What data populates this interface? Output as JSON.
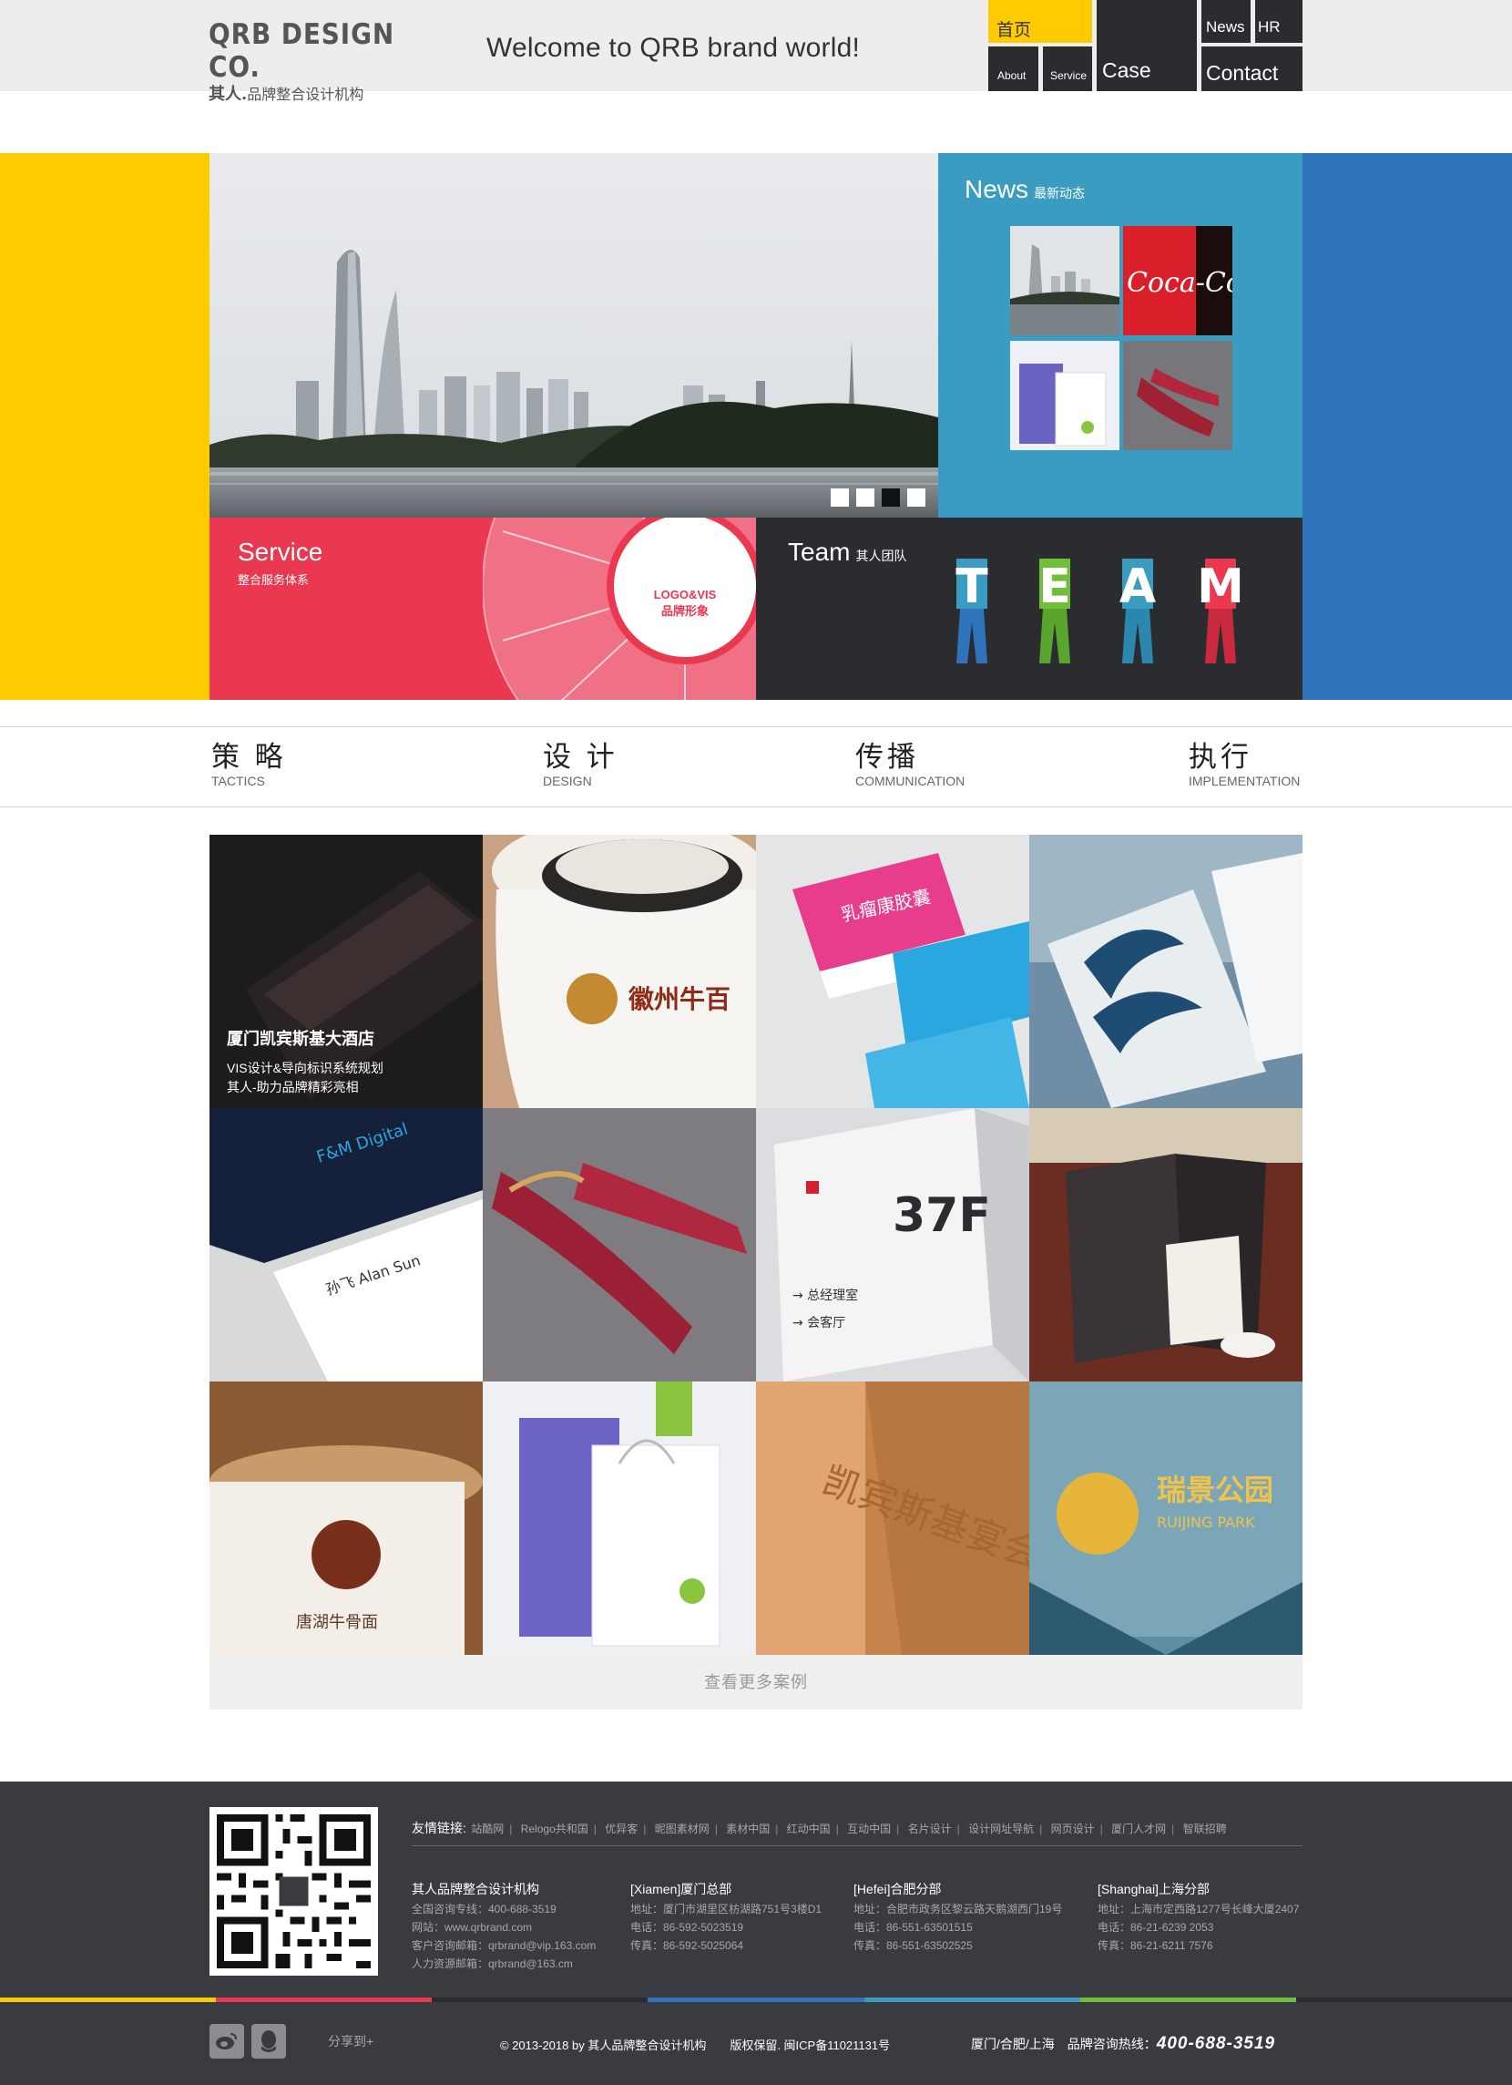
{
  "header": {
    "logo_main": "QRB DESIGN CO.",
    "logo_mark": "其人.",
    "logo_sub": "品牌整合设计机构",
    "welcome": "Welcome to QRB brand world!",
    "nav": {
      "home": "首页",
      "about": "About",
      "service": "Service",
      "case": "Case",
      "news": "News",
      "hr": "HR",
      "contact": "Contact"
    }
  },
  "banner": {
    "slider_dots": 4,
    "active_dot": 3,
    "news": {
      "title": "News",
      "subtitle": "最新动态"
    },
    "service": {
      "title": "Service",
      "subtitle": "整合服务体系",
      "center_line1": "LOGO&VIS",
      "center_line2": "品牌形象"
    },
    "team": {
      "title": "Team",
      "subtitle": "其人团队",
      "letters": [
        "T",
        "E",
        "A",
        "M"
      ]
    }
  },
  "strategy": [
    {
      "cn": "策 略",
      "en": "TACTICS"
    },
    {
      "cn": "设 计",
      "en": "DESIGN"
    },
    {
      "cn": "传播",
      "en": "COMMUNICATION"
    },
    {
      "cn": "执行",
      "en": "IMPLEMENTATION"
    }
  ],
  "cases": {
    "featured": {
      "title": "厦门凯宾斯基大酒店",
      "line1": "VIS设计&导向标识系统规划",
      "line2": "其人-助力品牌精彩亮相"
    },
    "more": "查看更多案例"
  },
  "footer": {
    "links_label": "友情链接:",
    "links": [
      "站酷网",
      "Relogo共和国",
      "优异客",
      "昵图素材网",
      "素材中国",
      "红动中国",
      "互动中国",
      "名片设计",
      "设计网址导航",
      "网页设计",
      "厦门人才网",
      "智联招聘"
    ],
    "offices": [
      {
        "head": "其人品牌整合设计机构",
        "l1": "全国咨询专线：400-688-3519",
        "l2": "网站：www.qrbrand.com",
        "l3": "客户咨询邮箱：qrbrand@vip.163.com",
        "l4": "人力资源邮箱：qrbrand@163.cm"
      },
      {
        "head": "[Xiamen]厦门总部",
        "l1": "地址：厦门市湖里区枋湖路751号3楼D1",
        "l2": "电话：86-592-5023519",
        "l3": "传真：86-592-5025064",
        "l4": ""
      },
      {
        "head": "[Hefei]合肥分部",
        "l1": "地址：合肥市政务区黎云路天鹅湖西门19号",
        "l2": "电话：86-551-63501515",
        "l3": "传真：86-551-63502525",
        "l4": ""
      },
      {
        "head": "[Shanghai]上海分部",
        "l1": "地址：上海市定西路1277号长峰大厦2407",
        "l2": "电话：86-21-6239 2053",
        "l3": "传真：86-21-6211 7576",
        "l4": ""
      }
    ],
    "share": "分享到+",
    "copyright": "© 2013-2018 by 其人品牌整合设计机构　　版权保留. 闽ICP备11021131号",
    "cities": "厦门/合肥/上海　品牌咨询热线：",
    "hotline": "400-688-3519",
    "strip_colors": [
      "#fecb00",
      "#ea3850",
      "#2b2c30",
      "#2e73bc",
      "#3a9cc1",
      "#6fbf3b",
      "#2b2c30"
    ]
  },
  "colors": {
    "yellow": "#fecb00",
    "blue": "#2e73bc",
    "teal": "#3a9cc1",
    "red": "#ea3850",
    "dark": "#2b2c30",
    "footer": "#3a3b40"
  }
}
